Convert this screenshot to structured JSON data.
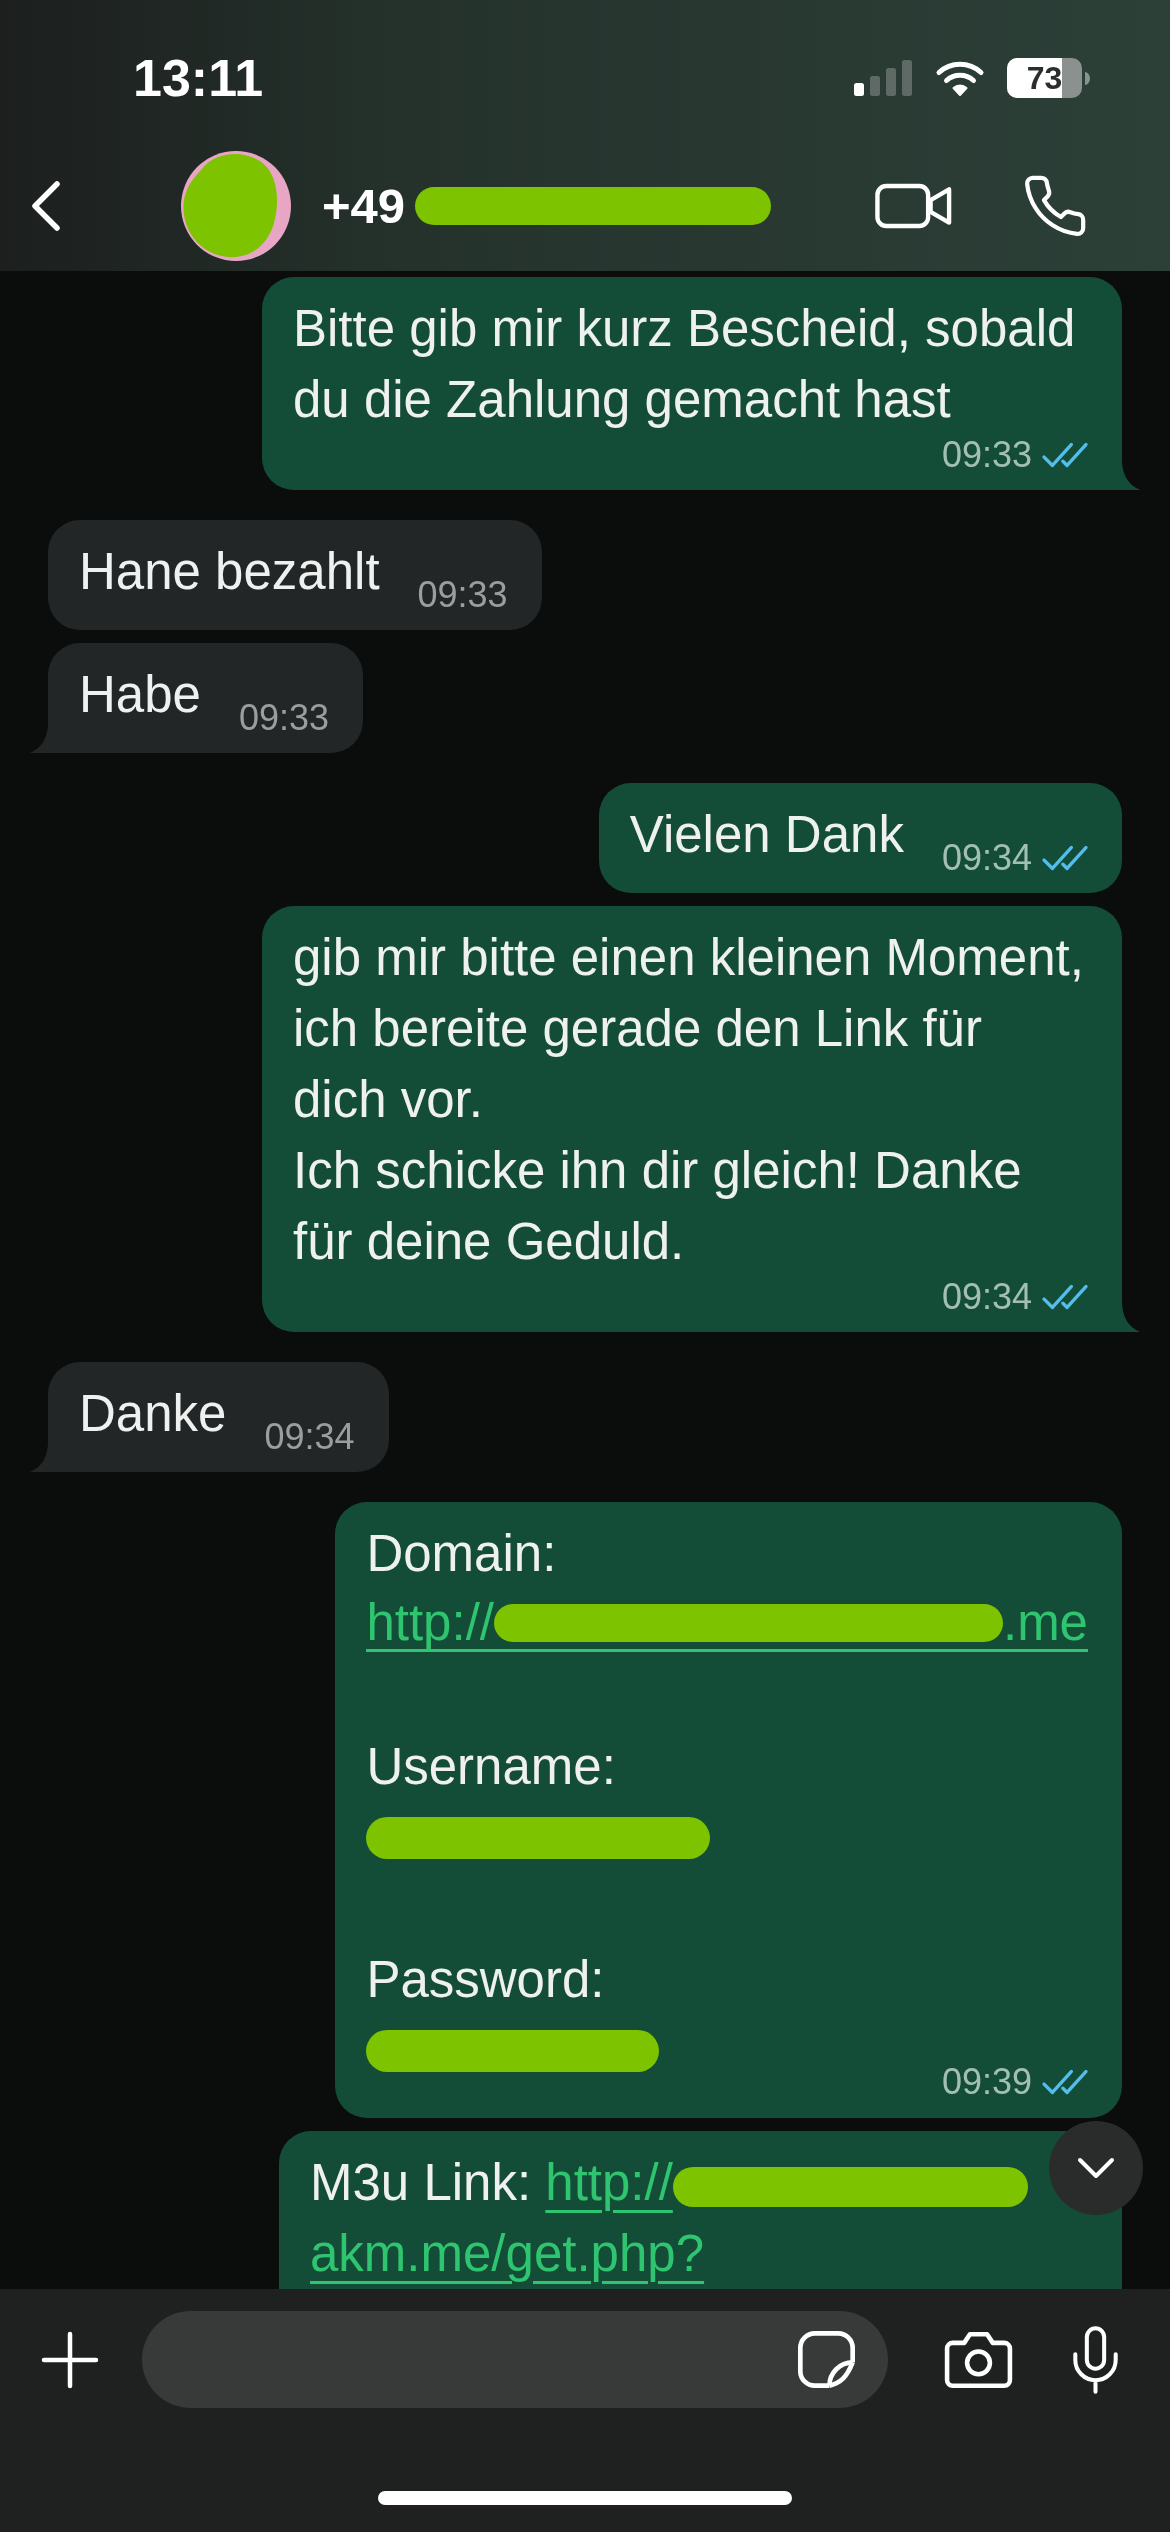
{
  "status_bar": {
    "time": "13:11",
    "battery": "73"
  },
  "header": {
    "avatar": {
      "redacted": true
    },
    "contact": {
      "name": "+49",
      "redacted": true
    }
  },
  "messages": [
    {
      "kind": "text",
      "outgoing": true,
      "text": "Bitte gib mir kurz Bescheid, sobald du die Zahlung gemacht hast",
      "time": "09:33",
      "read": true,
      "tail": true
    },
    {
      "kind": "text",
      "outgoing": false,
      "text": "Hane bezahlt",
      "time": "09:33",
      "tail": false
    },
    {
      "kind": "text",
      "outgoing": false,
      "text": "Habe",
      "time": "09:33",
      "tail": true
    },
    {
      "kind": "text",
      "outgoing": true,
      "text": "Vielen Dank",
      "time": "09:34",
      "read": true,
      "tail": false
    },
    {
      "kind": "text",
      "outgoing": true,
      "text": "gib mir bitte einen kleinen Moment, ich bereite gerade den Link für dich vor.\nIch schicke ihn dir gleich! Danke für deine Geduld.",
      "time": "09:34",
      "read": true,
      "tail": true
    },
    {
      "kind": "text",
      "outgoing": false,
      "text": "Danke",
      "time": "09:34",
      "tail": true
    },
    {
      "kind": "credentials",
      "outgoing": true,
      "fields": [
        {
          "label": "Domain:",
          "link_start": "http://",
          "link_end": ".me",
          "redacted": true
        },
        {
          "label": "Username:",
          "redacted": true
        },
        {
          "label": "Password:",
          "redacted": true
        }
      ],
      "time": "09:39",
      "read": true,
      "tail": false
    },
    {
      "kind": "link",
      "outgoing": true,
      "label": "M3u Link:",
      "link_start": "http://",
      "link_end": "akm.me/get.php?",
      "redacted": true,
      "tail": false
    }
  ]
}
